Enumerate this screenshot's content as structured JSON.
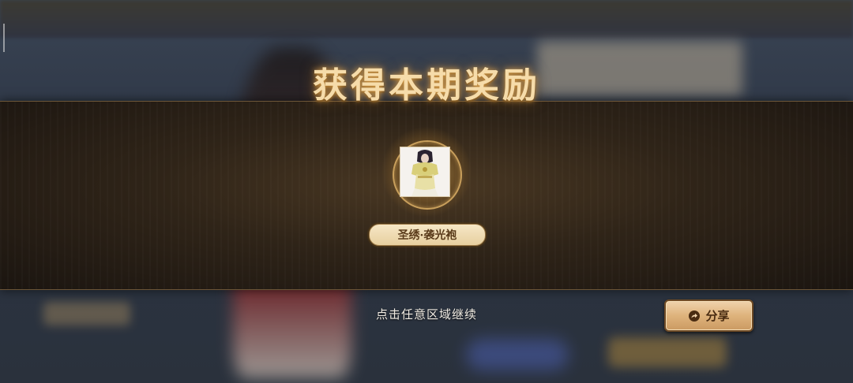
{
  "popup": {
    "title": "获得本期奖励",
    "reward": {
      "name": "圣绣·袭光袍",
      "icon": "costume-armor-icon"
    },
    "hint": "点击任意区域继续",
    "share_button": {
      "label": "分享",
      "icon": "share-icon"
    }
  },
  "colors": {
    "title": "#f6dcaa",
    "band": "#2f2418",
    "accent_gold": "#c89f5c",
    "button": "#deb37c"
  }
}
